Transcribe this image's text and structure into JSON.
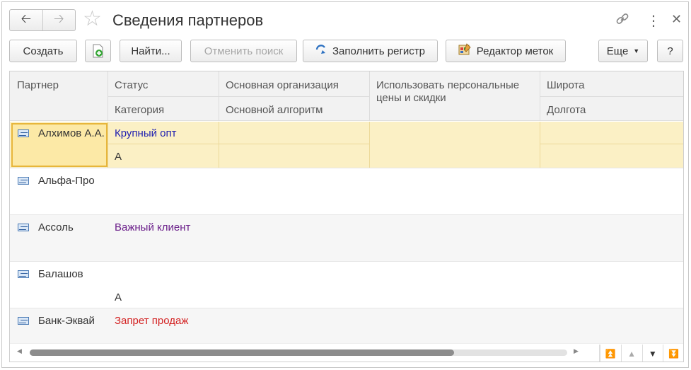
{
  "window": {
    "title": "Сведения партнеров"
  },
  "toolbar": {
    "create": "Создать",
    "find": "Найти...",
    "cancel_search": "Отменить поиск",
    "fill_register": "Заполнить регистр",
    "tag_editor": "Редактор меток",
    "more": "Еще",
    "help": "?"
  },
  "columns": {
    "partner": "Партнер",
    "status": "Статус",
    "category": "Категория",
    "org": "Основная организация",
    "algorithm": "Основной алгоритм",
    "personal_prices": "Использовать персональные цены и скидки",
    "latitude": "Широта",
    "longitude": "Долгота"
  },
  "rows": [
    {
      "partner": "Алхимов А.А.",
      "status": "Крупный опт",
      "status_color": "#1f1fb0",
      "category": "А"
    },
    {
      "partner": "Альфа-Про",
      "status": "",
      "status_color": "#333333",
      "category": ""
    },
    {
      "partner": "Ассоль",
      "status": "Важный клиент",
      "status_color": "#6b1f8a",
      "category": ""
    },
    {
      "partner": "Балашов",
      "status": "",
      "status_color": "#333333",
      "category": "А"
    },
    {
      "partner": "Банк-Эквай",
      "status": "Запрет продаж",
      "status_color": "#d32222",
      "category": ""
    }
  ],
  "colors": {
    "selected_row": "#fbf0c5",
    "focus_border": "#e7b63b"
  }
}
